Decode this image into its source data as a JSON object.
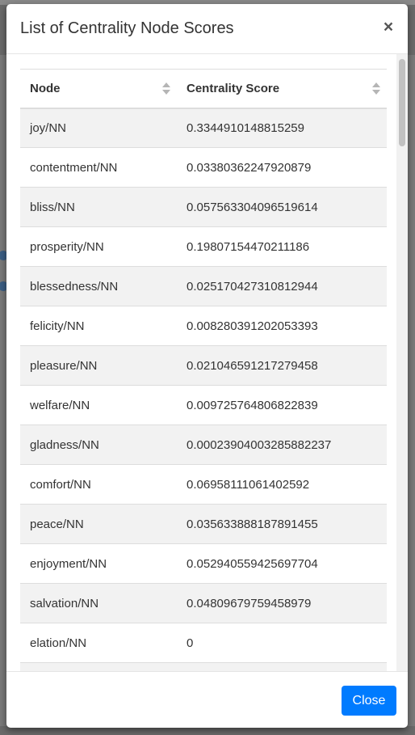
{
  "modal": {
    "title": "List of Centrality Node Scores",
    "close_icon": "×",
    "close_button_label": "Close"
  },
  "table": {
    "headers": [
      "Node",
      "Centrality Score"
    ],
    "rows": [
      [
        "joy/NN",
        "0.3344910148815259"
      ],
      [
        "contentment/NN",
        "0.03380362247920879"
      ],
      [
        "bliss/NN",
        "0.057563304096519614"
      ],
      [
        "prosperity/NN",
        "0.19807154470211186"
      ],
      [
        "blessedness/NN",
        "0.025170427310812944"
      ],
      [
        "felicity/NN",
        "0.008280391202053393"
      ],
      [
        "pleasure/NN",
        "0.021046591217279458"
      ],
      [
        "welfare/NN",
        "0.009725764806822839"
      ],
      [
        "gladness/NN",
        "0.00023904003285882237"
      ],
      [
        "comfort/NN",
        "0.06958111061402592"
      ],
      [
        "peace/NN",
        "0.035633888187891455"
      ],
      [
        "enjoyment/NN",
        "0.052940559425697704"
      ],
      [
        "salvation/NN",
        "0.04809679759458979"
      ],
      [
        "elation/NN",
        "0"
      ],
      [
        "",
        ""
      ]
    ]
  },
  "icons": {
    "sort": "sort-icon",
    "close": "close-icon"
  },
  "colors": {
    "primary_button": "#007bff",
    "striped_row": "#f2f2f2"
  }
}
